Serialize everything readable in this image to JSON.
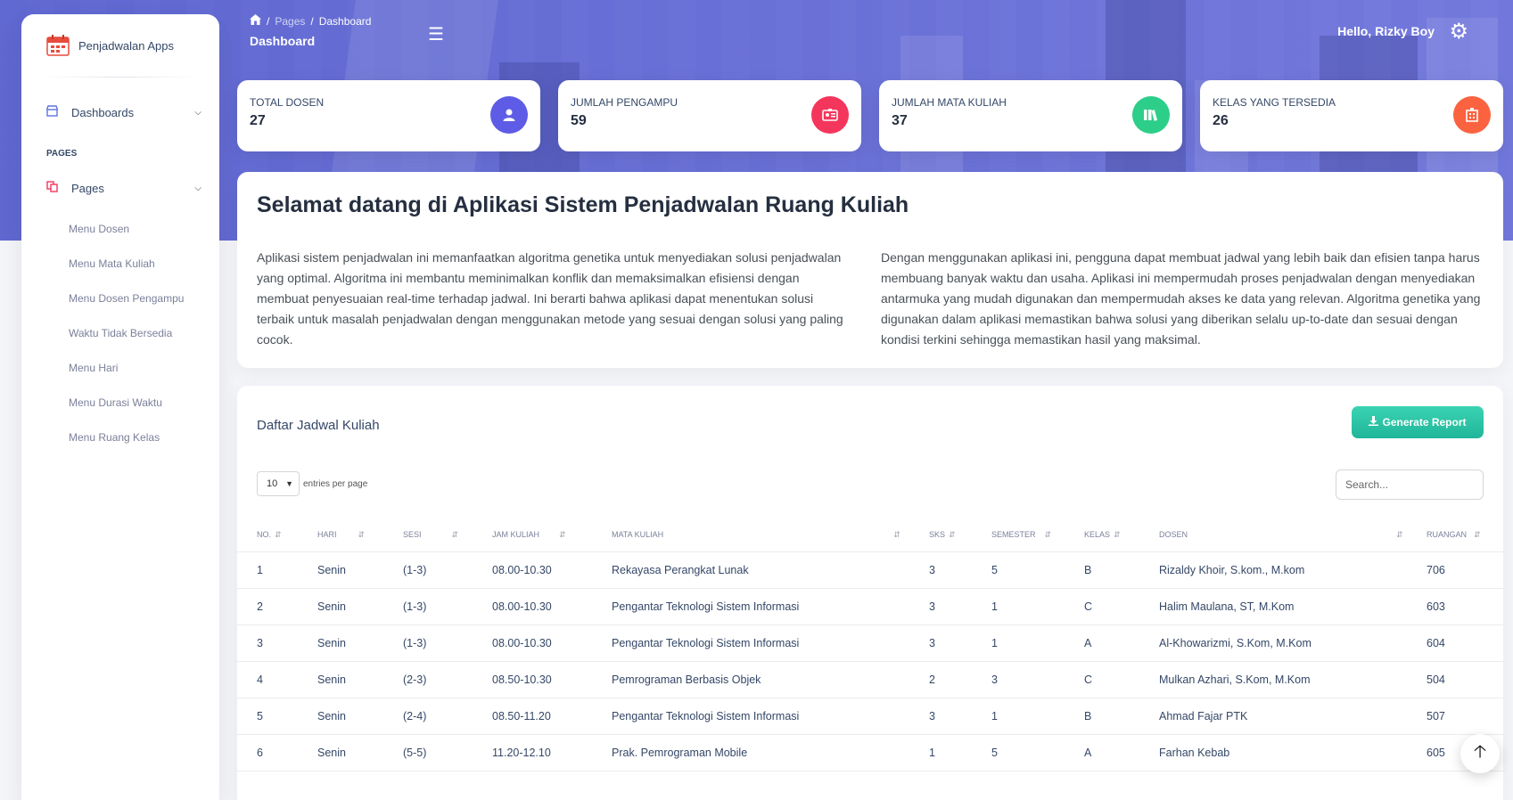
{
  "app": {
    "brand": "Penjadwalan Apps"
  },
  "sidebar": {
    "dashboards_label": "Dashboards",
    "section_label": "PAGES",
    "pages_label": "Pages",
    "items": [
      {
        "label": "Menu Dosen"
      },
      {
        "label": "Menu Mata Kuliah"
      },
      {
        "label": "Menu Dosen Pengampu"
      },
      {
        "label": "Waktu Tidak Bersedia"
      },
      {
        "label": "Menu Hari"
      },
      {
        "label": "Menu Durasi Waktu"
      },
      {
        "label": "Menu Ruang Kelas"
      }
    ]
  },
  "header": {
    "breadcrumb": {
      "sep": "/",
      "parent": "Pages",
      "current": "Dashboard"
    },
    "page_title": "Dashboard",
    "greeting": "Hello, Rizky Boy"
  },
  "stats": [
    {
      "label": "TOTAL DOSEN",
      "value": "27",
      "icon": "user-icon",
      "color": "#5e5ce6"
    },
    {
      "label": "JUMLAH PENGAMPU",
      "value": "59",
      "icon": "id-card-icon",
      "color": "#f5365c"
    },
    {
      "label": "JUMLAH MATA KULIAH",
      "value": "37",
      "icon": "books-icon",
      "color": "#2dce89"
    },
    {
      "label": "KELAS YANG TERSEDIA",
      "value": "26",
      "icon": "building-icon",
      "color": "#fb6340"
    }
  ],
  "welcome": {
    "title": "Selamat datang di Aplikasi Sistem Penjadwalan Ruang Kuliah",
    "para_left": "Aplikasi sistem penjadwalan ini memanfaatkan algoritma genetika untuk menyediakan solusi penjadwalan yang optimal. Algoritma ini membantu meminimalkan konflik dan memaksimalkan efisiensi dengan membuat penyesuaian real-time terhadap jadwal. Ini berarti bahwa aplikasi dapat menentukan solusi terbaik untuk masalah penjadwalan dengan menggunakan metode yang sesuai dengan solusi yang paling cocok.",
    "para_right": "Dengan menggunakan aplikasi ini, pengguna dapat membuat jadwal yang lebih baik dan efisien tanpa harus membuang banyak waktu dan usaha. Aplikasi ini mempermudah proses penjadwalan dengan menyediakan antarmuka yang mudah digunakan dan mempermudah akses ke data yang relevan. Algoritma genetika yang digunakan dalam aplikasi memastikan bahwa solusi yang diberikan selalu up-to-date dan sesuai dengan kondisi terkini sehingga memastikan hasil yang maksimal."
  },
  "schedule": {
    "title": "Daftar Jadwal Kuliah",
    "generate_label": "Generate Report",
    "page_length": "10",
    "entries_label": "entries per page",
    "search_placeholder": "Search...",
    "columns": [
      "NO.",
      "HARI",
      "SESI",
      "JAM KULIAH",
      "MATA KULIAH",
      "SKS",
      "SEMESTER",
      "KELAS",
      "DOSEN",
      "RUANGAN"
    ],
    "rows": [
      {
        "no": "1",
        "hari": "Senin",
        "sesi": "(1-3)",
        "jam": "08.00-10.30",
        "mk": "Rekayasa Perangkat Lunak",
        "sks": "3",
        "semester": "5",
        "kelas": "B",
        "dosen": "Rizaldy Khoir, S.kom., M.kom",
        "ruangan": "706"
      },
      {
        "no": "2",
        "hari": "Senin",
        "sesi": "(1-3)",
        "jam": "08.00-10.30",
        "mk": "Pengantar Teknologi Sistem Informasi",
        "sks": "3",
        "semester": "1",
        "kelas": "C",
        "dosen": "Halim Maulana, ST, M.Kom",
        "ruangan": "603"
      },
      {
        "no": "3",
        "hari": "Senin",
        "sesi": "(1-3)",
        "jam": "08.00-10.30",
        "mk": "Pengantar Teknologi Sistem Informasi",
        "sks": "3",
        "semester": "1",
        "kelas": "A",
        "dosen": "Al-Khowarizmi, S.Kom, M.Kom",
        "ruangan": "604"
      },
      {
        "no": "4",
        "hari": "Senin",
        "sesi": "(2-3)",
        "jam": "08.50-10.30",
        "mk": "Pemrograman Berbasis Objek",
        "sks": "2",
        "semester": "3",
        "kelas": "C",
        "dosen": "Mulkan Azhari, S.Kom, M.Kom",
        "ruangan": "504"
      },
      {
        "no": "5",
        "hari": "Senin",
        "sesi": "(2-4)",
        "jam": "08.50-11.20",
        "mk": "Pengantar Teknologi Sistem Informasi",
        "sks": "3",
        "semester": "1",
        "kelas": "B",
        "dosen": "Ahmad Fajar PTK",
        "ruangan": "507"
      },
      {
        "no": "6",
        "hari": "Senin",
        "sesi": "(5-5)",
        "jam": "11.20-12.10",
        "mk": "Prak. Pemrograman Mobile",
        "sks": "1",
        "semester": "5",
        "kelas": "A",
        "dosen": "Farhan Kebab",
        "ruangan": "605"
      }
    ]
  },
  "icons": {
    "brand": "calendar-icon",
    "dashboards": "shop-icon",
    "pages": "copy-icon",
    "home": "home-icon",
    "menu": "hamburger-icon",
    "settings": "gear-icon",
    "download": "download-icon",
    "scroll_top": "arrow-up-icon"
  }
}
